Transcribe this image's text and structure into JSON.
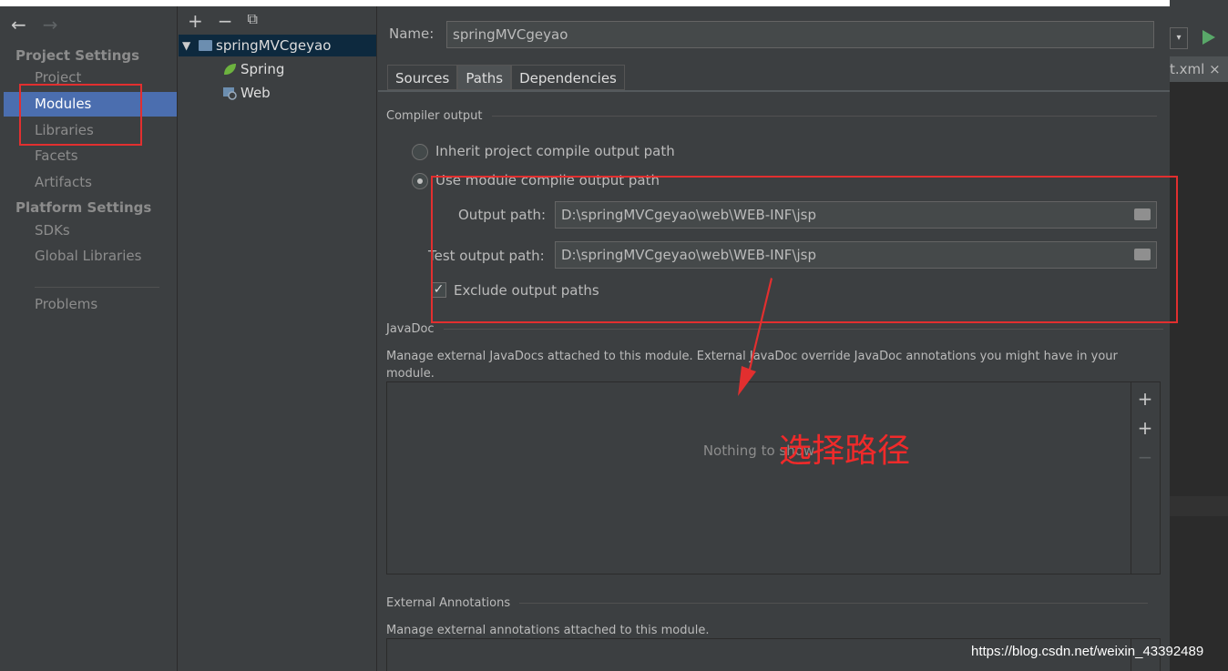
{
  "left_nav": {
    "back_icon": "arrow-left-icon",
    "forward_icon": "arrow-right-icon",
    "project_settings_header": "Project Settings",
    "project_items": [
      "Project",
      "Modules",
      "Libraries",
      "Facets",
      "Artifacts"
    ],
    "platform_settings_header": "Platform Settings",
    "platform_items": [
      "SDKs",
      "Global Libraries"
    ],
    "problems": "Problems",
    "selected": "Modules"
  },
  "tree": {
    "toolbar": {
      "add": "+",
      "remove": "−",
      "copy": "copy-icon"
    },
    "root": "springMVCgeyao",
    "children": [
      "Spring",
      "Web"
    ]
  },
  "main": {
    "name_label": "Name:",
    "name_value": "springMVCgeyao",
    "tabs": [
      "Sources",
      "Paths",
      "Dependencies"
    ],
    "active_tab": "Paths",
    "compiler_output_title": "Compiler output",
    "inherit_label": "Inherit project compile output path",
    "use_module_label": "Use module compile output path",
    "output_path_label": "Output path:",
    "output_path_value": "D:\\springMVCgeyao\\web\\WEB-INF\\jsp",
    "test_output_path_label": "Test output path:",
    "test_output_path_value": "D:\\springMVCgeyao\\web\\WEB-INF\\jsp",
    "exclude_label": "Exclude output paths",
    "exclude_checked": true,
    "javadoc_title": "JavaDoc",
    "javadoc_desc": "Manage external JavaDocs attached to this module. External JavaDoc override JavaDoc annotations you might have in your module.",
    "javadoc_empty": "Nothing to show",
    "external_annotations_title": "External Annotations",
    "external_annotations_desc": "Manage external annotations attached to this module."
  },
  "annotation": {
    "text": "选择路径",
    "color": "#e22f2f"
  },
  "editor_strip": {
    "tab_label": "t.xml ×"
  },
  "watermark": "https://blog.csdn.net/weixin_43392489"
}
